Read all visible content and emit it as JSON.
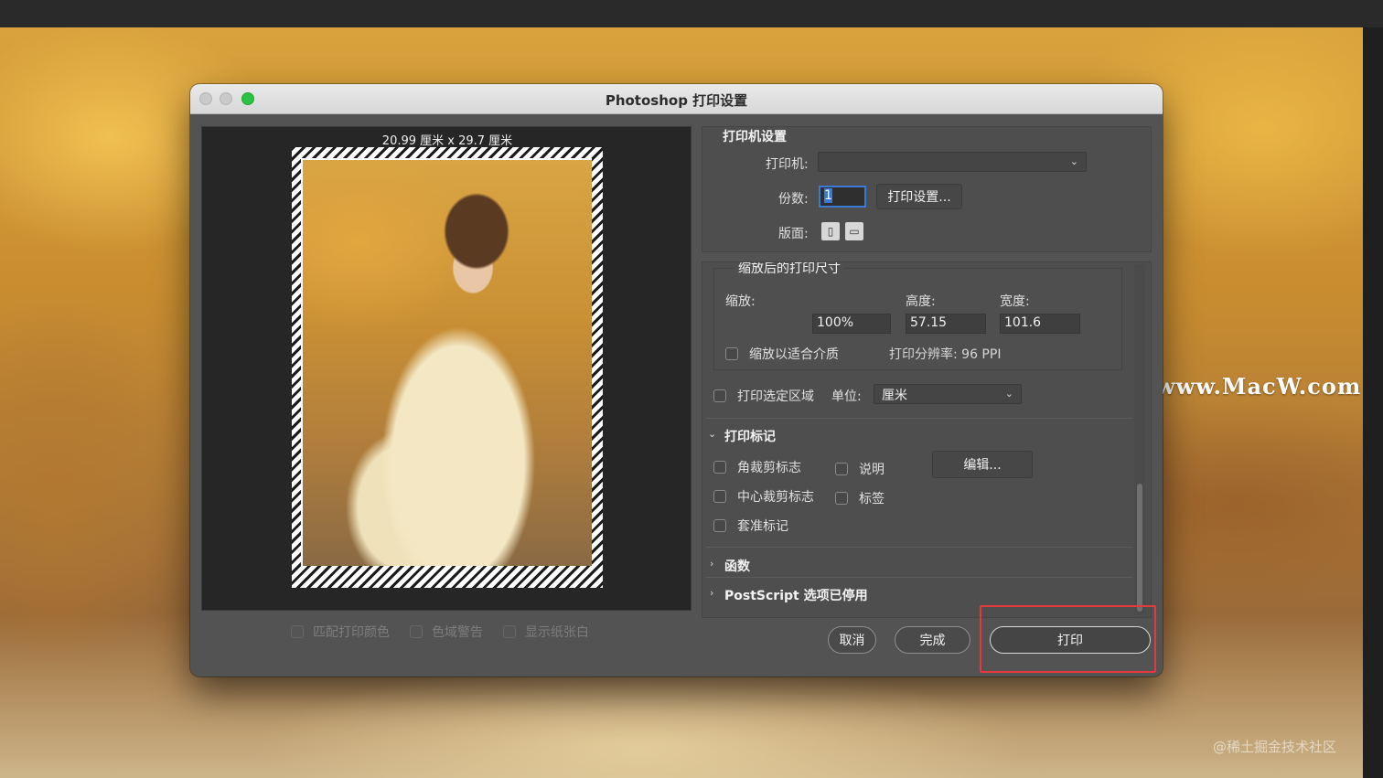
{
  "dialog": {
    "title": "Photoshop 打印设置",
    "paper_size": "20.99 厘米 x 29.7 厘米",
    "preview_options": [
      {
        "label": "匹配打印颜色"
      },
      {
        "label": "色域警告"
      },
      {
        "label": "显示纸张白"
      }
    ]
  },
  "printer_settings": {
    "title": "打印机设置",
    "printer_label": "打印机:",
    "printer_value": "",
    "copies_label": "份数:",
    "copies_value": "1",
    "print_settings_button": "打印设置...",
    "layout_label": "版面:"
  },
  "scaled_size": {
    "title": "缩放后的打印尺寸",
    "scale_label": "缩放:",
    "height_label": "高度:",
    "width_label": "宽度:",
    "scale_value": "100%",
    "height_value": "57.15",
    "width_value": "101.6",
    "fit_media_label": "缩放以适合介质",
    "resolution_text": "打印分辨率: 96 PPI"
  },
  "print_selection": {
    "label": "打印选定区域",
    "unit_label": "单位:",
    "unit_value": "厘米"
  },
  "print_marks": {
    "title": "打印标记",
    "corner_crop": "角裁剪标志",
    "center_crop": "中心裁剪标志",
    "registration": "套准标记",
    "description": "说明",
    "labels": "标签",
    "edit_button": "编辑..."
  },
  "functions": {
    "title": "函数"
  },
  "postscript": {
    "title": "PostScript 选项已停用"
  },
  "buttons": {
    "cancel": "取消",
    "done": "完成",
    "print": "打印"
  },
  "watermark": "www.MacW.com",
  "credit": "@稀土掘金技术社区",
  "colors": {
    "dialog_bg": "#535353",
    "accent_focus": "#3b79d6",
    "highlight": "#e5393b",
    "maximize_green": "#2ac244"
  }
}
